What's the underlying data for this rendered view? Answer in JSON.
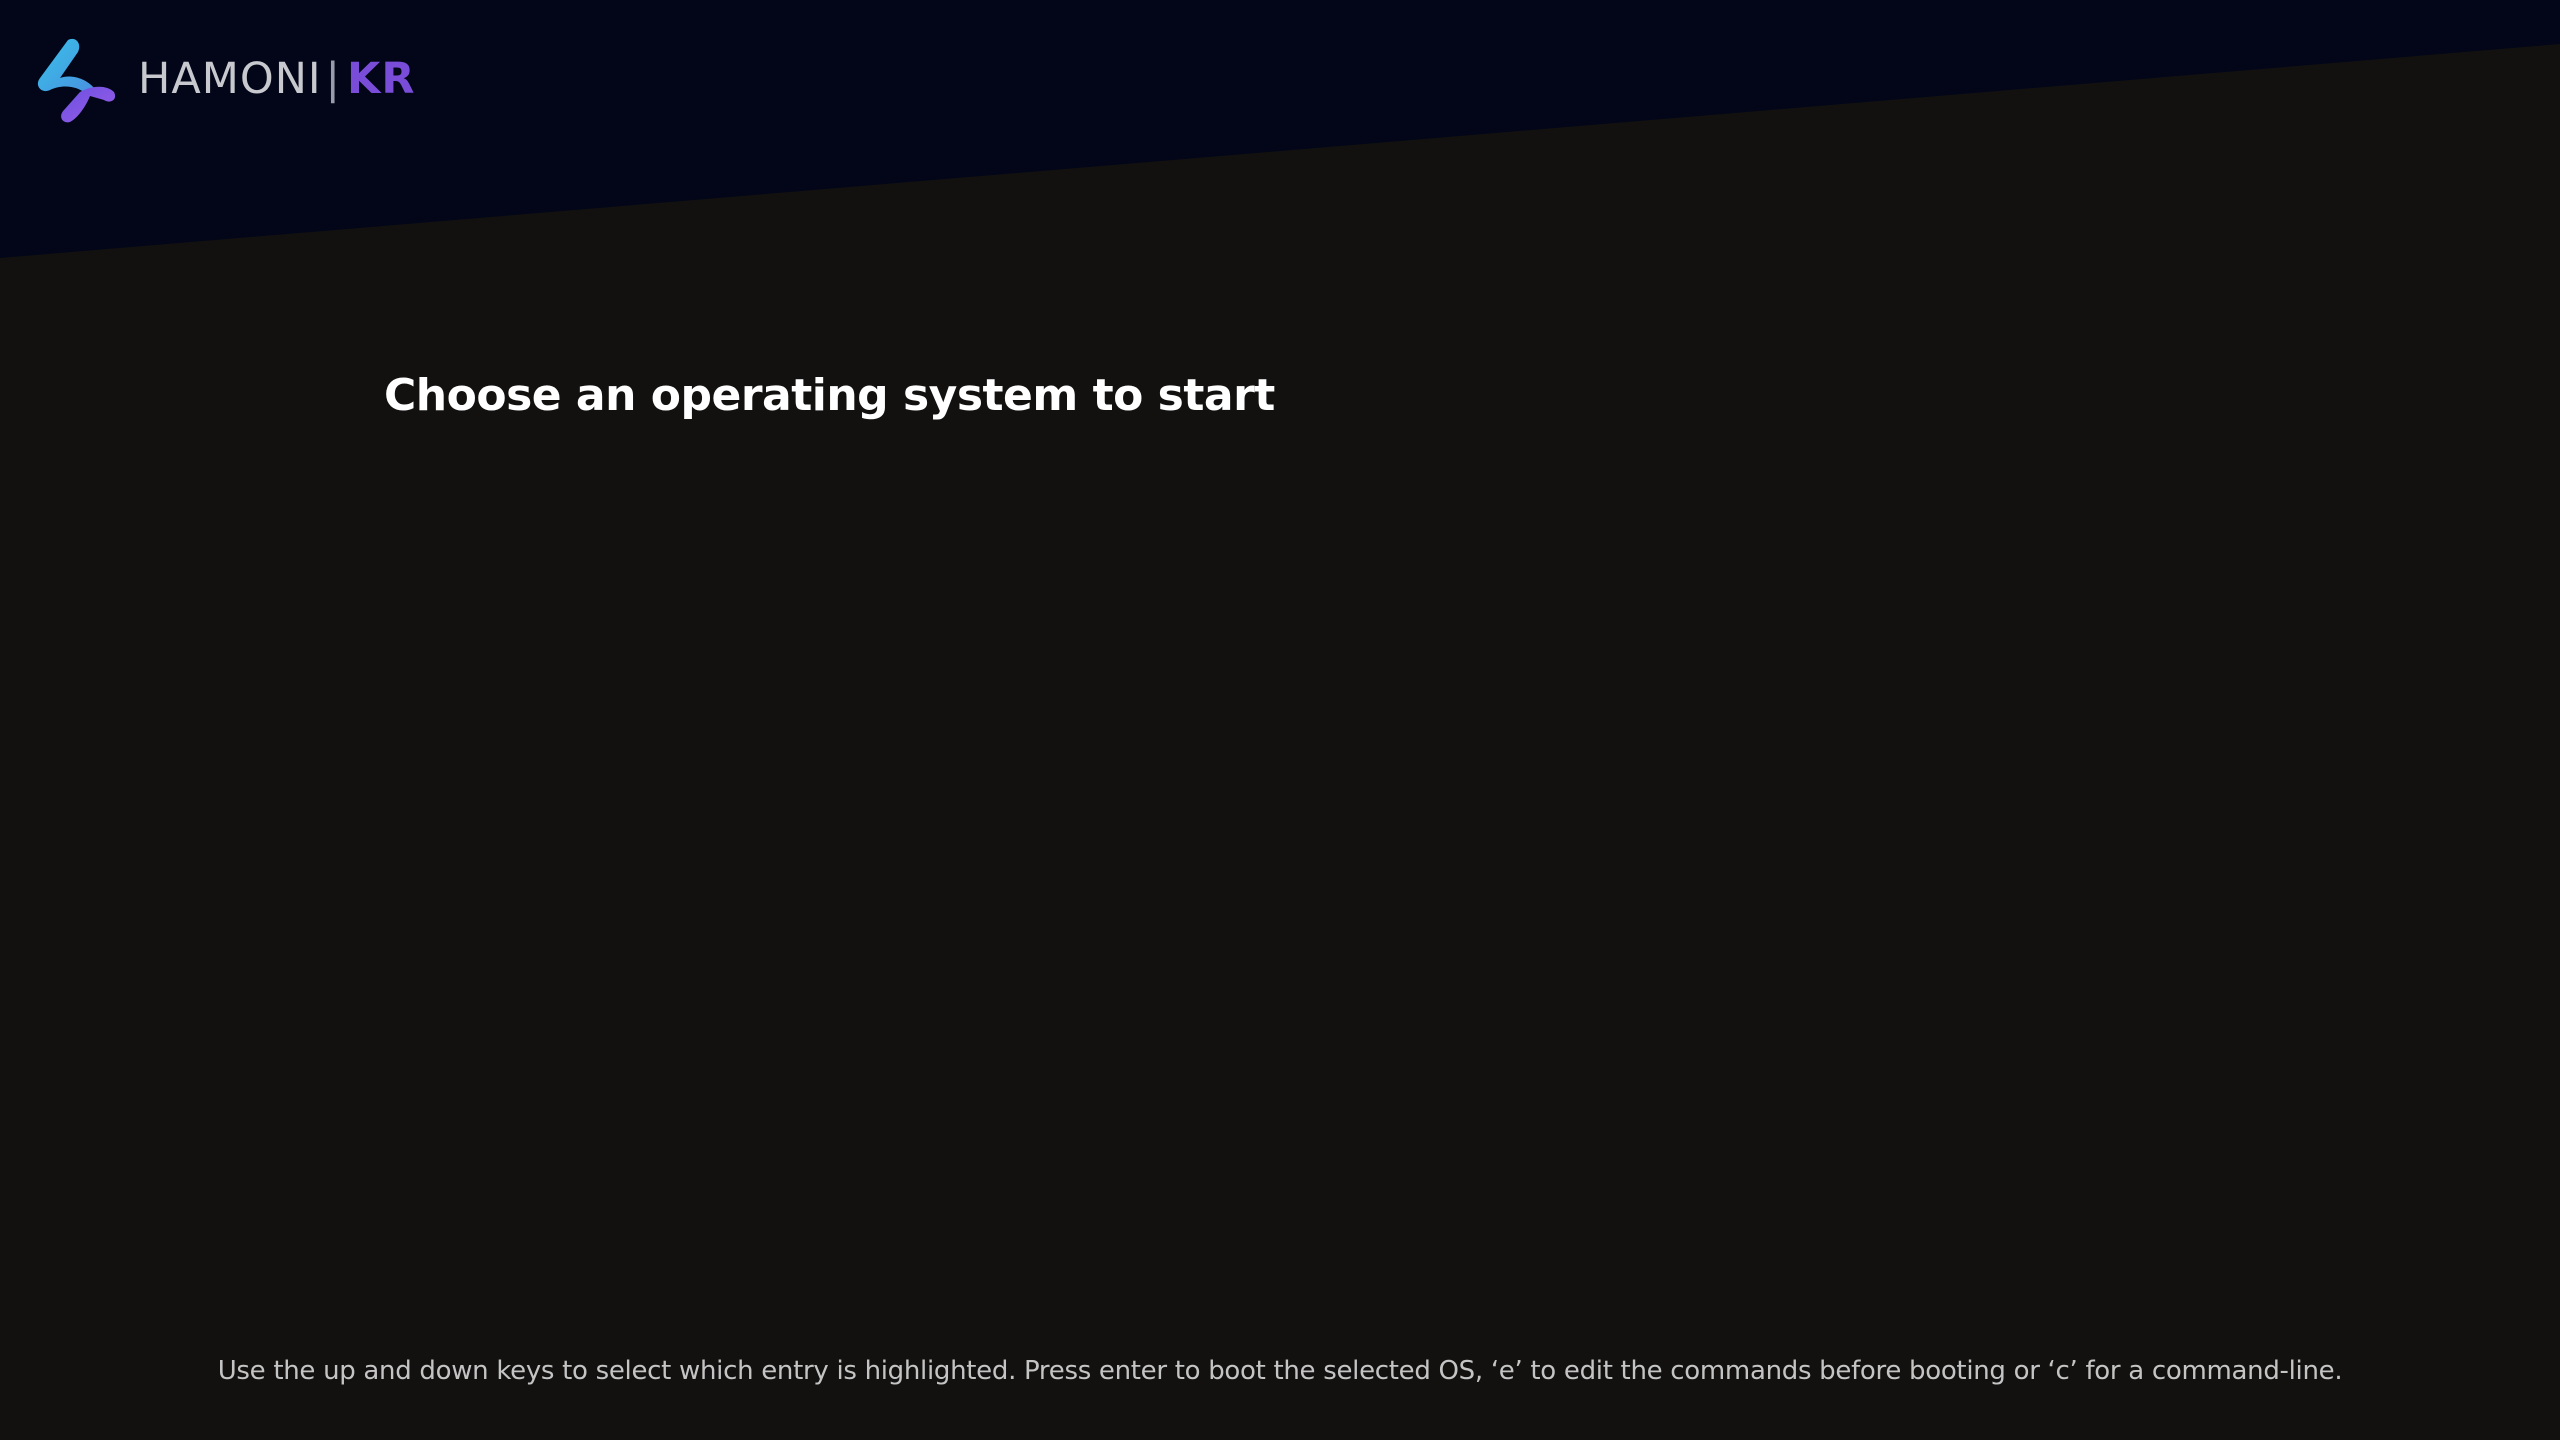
{
  "brand": {
    "name_part1": "HAMONI",
    "name_part2": "KR",
    "logo_icon": "hamonikr-logo-icon"
  },
  "menu": {
    "title": "Choose an operating system to start",
    "entries": []
  },
  "footer": {
    "help_text": "Use the up and down keys to select which entry is highlighted. Press enter to boot the selected OS, ‘e’ to edit the commands before booting or ‘c’ for a command-line."
  },
  "colors": {
    "background": "#121110",
    "top_band": "#020618",
    "logo_accent": "#7a4dd8",
    "logo_cyan": "#39b3e6",
    "title": "#ffffff",
    "help_text": "#c4c4c4"
  }
}
